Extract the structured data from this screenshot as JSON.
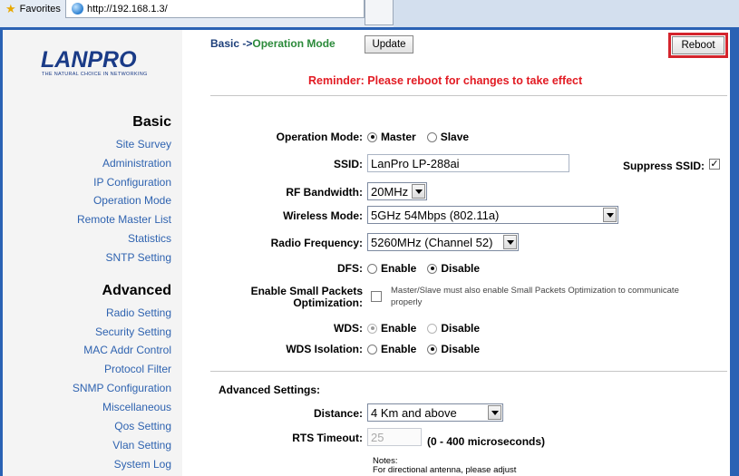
{
  "browser": {
    "favorites_label": "Favorites",
    "tab_url": "http://192.168.1.3/"
  },
  "brand": {
    "name": "LANPRO",
    "tagline": "THE NATURAL CHOICE IN NETWORKING",
    "color": "#1a3b87"
  },
  "sidebar": {
    "basic_title": "Basic",
    "basic_items": [
      "Site Survey",
      "Administration",
      "IP Configuration",
      "Operation Mode",
      "Remote Master List",
      "Statistics",
      "SNTP Setting"
    ],
    "advanced_title": "Advanced",
    "advanced_items": [
      "Radio Setting",
      "Security Setting",
      "MAC Addr Control",
      "Protocol Filter",
      "SNMP Configuration",
      "Miscellaneous",
      "Qos Setting",
      "Vlan Setting",
      "System Log"
    ],
    "link_color": "#2f63b0"
  },
  "header": {
    "breadcrumb_base": "Basic ->",
    "breadcrumb_current": "Operation Mode",
    "update_label": "Update",
    "reboot_label": "Reboot",
    "reminder": "Reminder: Please reboot for changes to take effect",
    "reminder_color": "#e21b23"
  },
  "form": {
    "operation_mode": {
      "label": "Operation Mode:",
      "options": [
        "Master",
        "Slave"
      ],
      "selected": "Master"
    },
    "ssid": {
      "label": "SSID:",
      "value": "LanPro LP-288ai"
    },
    "suppress_ssid": {
      "label": "Suppress SSID:",
      "checked": true,
      "mark": "✓"
    },
    "rf_bandwidth": {
      "label": "RF Bandwidth:",
      "value": "20MHz"
    },
    "wireless_mode": {
      "label": "Wireless Mode:",
      "value": "5GHz 54Mbps (802.11a)"
    },
    "radio_frequency": {
      "label": "Radio Frequency:",
      "value": "5260MHz (Channel 52)"
    },
    "dfs": {
      "label": "DFS:",
      "options": [
        "Enable",
        "Disable"
      ],
      "selected": "Disable"
    },
    "small_packets": {
      "label_line1": "Enable Small Packets",
      "label_line2": "Optimization:",
      "checked": false,
      "note": "Master/Slave must also enable Small Packets Optimization to communicate properly"
    },
    "wds": {
      "label": "WDS:",
      "options": [
        "Enable",
        "Disable"
      ],
      "selected": "Enable"
    },
    "wds_isolation": {
      "label": "WDS Isolation:",
      "options": [
        "Enable",
        "Disable"
      ],
      "selected": "Disable"
    }
  },
  "advanced": {
    "title": "Advanced Settings:",
    "distance": {
      "label": "Distance:",
      "value": "4 Km and above"
    },
    "rts_timeout": {
      "label": "RTS Timeout:",
      "value": "25",
      "range": "(0 - 400 microseconds)"
    },
    "notes_title": "Notes:",
    "notes_text": "For directional antenna, please adjust"
  }
}
